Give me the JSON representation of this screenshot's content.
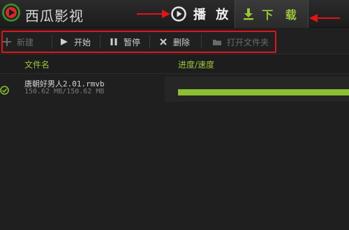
{
  "app": {
    "title": "西瓜影视"
  },
  "header": {
    "play_label": "播 放",
    "download_label": "下 载",
    "accent_green": "#9dc43a",
    "annotation_red": "#e1141a"
  },
  "toolbar": {
    "new_label": "新建",
    "start_label": "开始",
    "pause_label": "暂停",
    "delete_label": "删除",
    "open_folder_label": "打开文件夹"
  },
  "columns": {
    "name": "文件名",
    "progress": "进度/速度"
  },
  "downloads": [
    {
      "file_name": "唐朝好男人2.01.rmvb",
      "size": "150.62 MB/150.62 MB",
      "progress": 1.0,
      "status_icon": "check-circle-icon"
    }
  ]
}
